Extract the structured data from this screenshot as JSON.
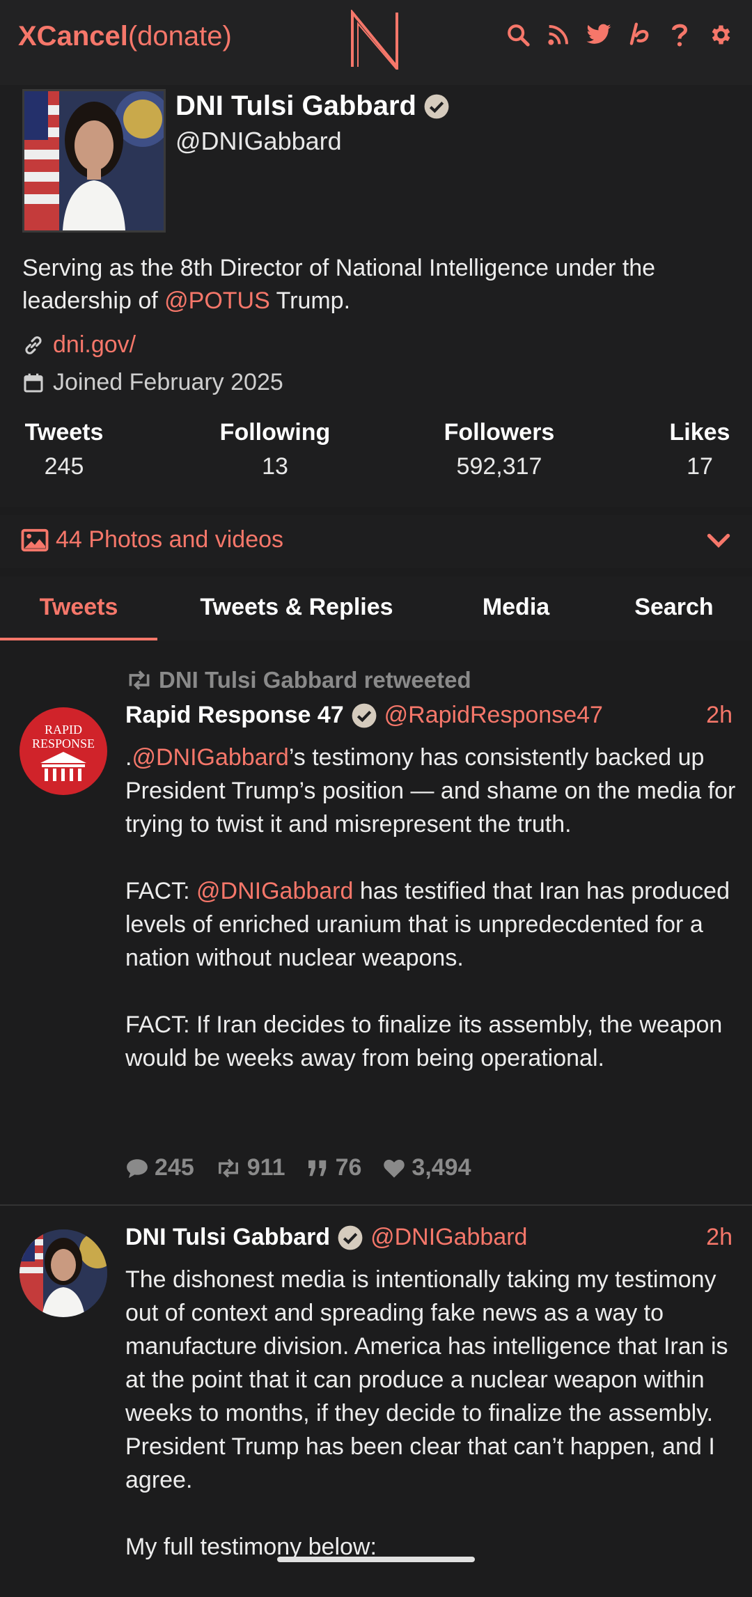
{
  "nav": {
    "brand_bold": "XCancel",
    "brand_rest": "(donate)",
    "icons": [
      "search-icon",
      "rss-icon",
      "twitter-icon",
      "liberapay-icon",
      "help-icon",
      "gear-icon"
    ]
  },
  "profile": {
    "name": "DNI Tulsi Gabbard",
    "handle": "@DNIGabbard",
    "bio_before": "Serving as the 8th Director of National Intelligence under the leadership of ",
    "bio_mention": "@POTUS",
    "bio_after": " Trump.",
    "website": "dni.gov/",
    "joined": "Joined February 2025",
    "stats": [
      {
        "label": "Tweets",
        "value": "245"
      },
      {
        "label": "Following",
        "value": "13"
      },
      {
        "label": "Followers",
        "value": "592,317"
      },
      {
        "label": "Likes",
        "value": "17"
      }
    ]
  },
  "photos": {
    "label": "44 Photos and videos"
  },
  "tabs": [
    "Tweets",
    "Tweets & Replies",
    "Media",
    "Search"
  ],
  "tweets": [
    {
      "retweeted_by": "DNI Tulsi Gabbard retweeted",
      "avatar_text": [
        "RAPID",
        "RESPONSE"
      ],
      "name": "Rapid Response 47",
      "handle": "@RapidResponse47",
      "time": "2h",
      "p1_pre": ".",
      "p1_mention": "@DNIGabbard",
      "p1_post": "’s testimony has consistently backed up President Trump’s position — and shame on the media for trying to twist it and misrepresent the truth.",
      "p2_pre": "FACT: ",
      "p2_mention": "@DNIGabbard",
      "p2_post": " has testified that Iran has produced levels of enriched uranium that is unpredecdented for a nation without nuclear weapons.",
      "p3": "FACT: If Iran decides to finalize its assembly, the weapon would be weeks away from being operational.",
      "replies": "245",
      "retweets": "911",
      "quotes": "76",
      "likes": "3,494"
    },
    {
      "name": "DNI Tulsi Gabbard",
      "handle": "@DNIGabbard",
      "time": "2h",
      "p1": "The dishonest media is intentionally taking my testimony out of context and spreading fake news as a way to manufacture division. America has intelligence that Iran is at the point that it can produce a nuclear weapon within weeks to months, if they decide to finalize the assembly. President Trump has been clear that can’t happen, and I agree.",
      "p2": "My full testimony below:"
    }
  ],
  "colors": {
    "accent": "#f6776a",
    "background": "#1c1c1d"
  }
}
